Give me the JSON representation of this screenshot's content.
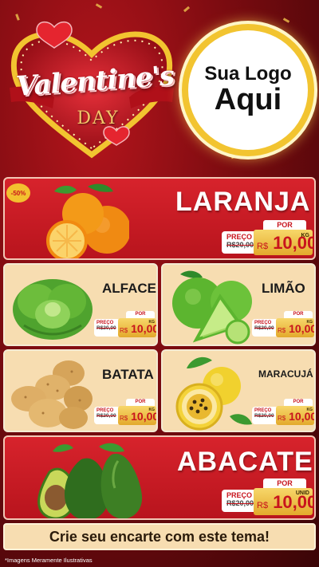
{
  "header": {
    "title_script": "Valentine's",
    "title_day": "DAY",
    "logo_line1": "Sua Logo",
    "logo_line2": "Aqui"
  },
  "products": {
    "laranja": {
      "name": "LARANJA",
      "badge": "-50%",
      "preco_label": "PREÇO",
      "old_price": "R$20,00",
      "por_label": "POR",
      "currency": "R$",
      "price": "10,00",
      "unit": "KG"
    },
    "alface": {
      "name": "ALFACE",
      "preco_label": "PREÇO",
      "old_price": "R$20,00",
      "por_label": "POR",
      "currency": "R$",
      "price": "10,00",
      "unit": "KG"
    },
    "limao": {
      "name": "LIMÃO",
      "preco_label": "PREÇO",
      "old_price": "R$20,00",
      "por_label": "POR",
      "currency": "R$",
      "price": "10,00",
      "unit": "KG"
    },
    "batata": {
      "name": "BATATA",
      "preco_label": "PREÇO",
      "old_price": "R$20,00",
      "por_label": "POR",
      "currency": "R$",
      "price": "10,00",
      "unit": "KG"
    },
    "maracuja": {
      "name": "MARACUJÁ",
      "preco_label": "PREÇO",
      "old_price": "R$20,00",
      "por_label": "POR",
      "currency": "R$",
      "price": "10,00",
      "unit": "KG"
    },
    "abacate": {
      "name": "ABACATE",
      "preco_label": "PREÇO",
      "old_price": "R$20,00",
      "por_label": "POR",
      "currency": "R$",
      "price": "10,00",
      "unit": "UNID"
    }
  },
  "cta": "Crie seu encarte com este tema!",
  "disclaimer": "*Imagens Meramente Ilustrativas",
  "colors": {
    "red": "#c8141d",
    "gold": "#f2c430",
    "cream": "#f7ddb1"
  }
}
